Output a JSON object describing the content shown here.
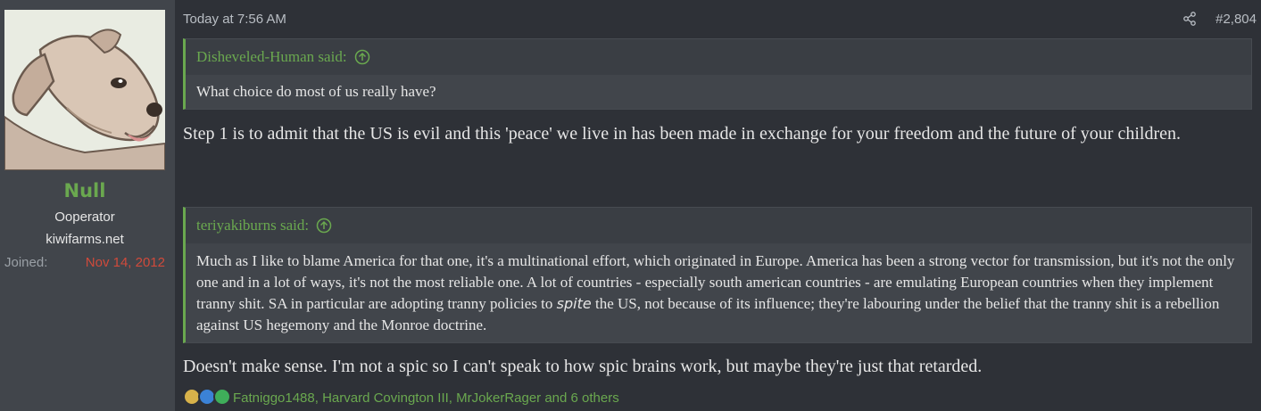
{
  "user": {
    "name": "Null",
    "title": "Ooperator",
    "domain": "kiwifarms.net",
    "joined_label": "Joined:",
    "joined_date": "Nov 14, 2012",
    "avatar_icon": "dog-avatar",
    "name_color": "#6aa84f"
  },
  "post": {
    "timestamp": "Today at 7:56 AM",
    "number": "#2,804",
    "share_icon": "share-icon",
    "quotes": [
      {
        "author": "Disheveled-Human said:",
        "text": "What choice do most of us really have?"
      },
      {
        "author": "teriyakiburns said:",
        "text_before": "Much as I like to blame America for that one, it's a multinational effort, which originated in Europe. America has been a strong vector for transmission, but it's not the only one and in a lot of ways, it's not the most reliable one. A lot of countries - especially south american countries - are emulating European countries when they implement tranny shit. SA in particular are adopting tranny policies to ",
        "text_emphasis": "spite",
        "text_after": " the US, not because of its influence; they're labouring under the belief that the tranny shit is a rebellion against US hegemony and the Monroe doctrine."
      }
    ],
    "paragraphs": [
      "Step 1 is to admit that the US is evil and this 'peace' we live in has been made in exchange for your freedom and the future of your children.",
      "Doesn't make sense. I'm not a spic so I can't speak to how spic brains work, but maybe they're just that retarded."
    ],
    "reactions": {
      "icons": [
        "medal-icon",
        "thumbs-up-icon",
        "check-icon"
      ],
      "users": "Fatniggo1488, Harvard Covington III, MrJokerRager and 6 others"
    }
  },
  "colors": {
    "accent": "#6aa84f",
    "joined_date": "#d04a3b",
    "background": "#2e3137",
    "sidebar": "#41454b"
  }
}
